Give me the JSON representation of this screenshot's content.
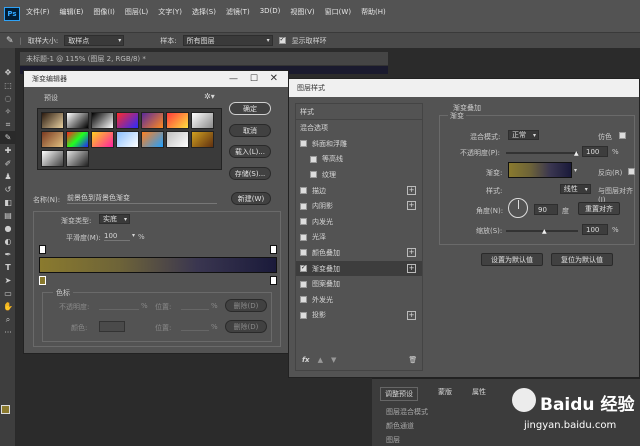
{
  "menubar": {
    "items": [
      "文件(F)",
      "编辑(E)",
      "图像(I)",
      "图层(L)",
      "文字(Y)",
      "选择(S)",
      "滤镜(T)",
      "3D(D)",
      "视图(V)",
      "窗口(W)",
      "帮助(H)"
    ],
    "app_badge": "Ps"
  },
  "optionsbar": {
    "sample_size_label": "取样大小:",
    "sample_size_value": "取样点",
    "sample_label": "样本:",
    "sample_value": "所有图层",
    "show_ring_label": "显示取样环"
  },
  "document": {
    "title": "未标题-1 @ 115% (图层 2, RGB/8) *"
  },
  "gradient_editor": {
    "title": "渐变编辑器",
    "presets_label": "预设",
    "btn_ok": "确定",
    "btn_cancel": "取消",
    "btn_load": "载入(L)...",
    "btn_save": "存储(S)...",
    "btn_new": "新建(W)",
    "name_label": "名称(N):",
    "name_value": "前景色到背景色渐变",
    "type_label": "渐变类型:",
    "type_value": "实底",
    "smooth_label": "平滑度(M):",
    "smooth_value": "100",
    "percent": "%",
    "stops_label": "色标",
    "opacity_label": "不透明度:",
    "color_label": "颜色:",
    "location_label": "位置:",
    "delete_label": "删除(D)",
    "gradient_colors": [
      "#8a7a2e",
      "#6e6438",
      "#3a3650",
      "#1a1a3a"
    ],
    "preset_colors": [
      [
        "#2b1a0f",
        "#e8d0a0"
      ],
      [
        "#ffffff",
        "#000000"
      ],
      [
        "#000000",
        "#ffffff"
      ],
      [
        "#ff2a2a",
        "#2a2aff"
      ],
      [
        "#5a2a9a",
        "#ff8a20"
      ],
      [
        "#ff3a3a",
        "#ffe040"
      ],
      [
        "#ffffff",
        "#8a8a8a"
      ],
      [
        "#7a3a20",
        "#e0c080"
      ],
      [
        "#ff2020",
        "#20ff20",
        "#2020ff"
      ],
      [
        "#ffd020",
        "#ff20a0"
      ],
      [
        "#8ac0ff",
        "#ffffff"
      ],
      [
        "#ff8020",
        "#20a0ff"
      ],
      [
        "#c0c0c0",
        "#ffffff"
      ],
      [
        "#d0a020",
        "#603010"
      ],
      [
        "#ffffff",
        "#404040"
      ],
      [
        "#e0e0e0",
        "#202020"
      ]
    ]
  },
  "layer_style": {
    "title": "图层样式",
    "styles_header": "样式",
    "blend_options": "混合选项",
    "items": [
      {
        "label": "斜面和浮雕",
        "checked": false,
        "plus": false
      },
      {
        "label": "等高线",
        "checked": false,
        "plus": false
      },
      {
        "label": "纹理",
        "checked": false,
        "plus": false
      },
      {
        "label": "描边",
        "checked": false,
        "plus": true
      },
      {
        "label": "内阴影",
        "checked": false,
        "plus": true
      },
      {
        "label": "内发光",
        "checked": false,
        "plus": false
      },
      {
        "label": "光泽",
        "checked": false,
        "plus": false
      },
      {
        "label": "颜色叠加",
        "checked": false,
        "plus": true
      },
      {
        "label": "渐变叠加",
        "checked": true,
        "plus": true
      },
      {
        "label": "图案叠加",
        "checked": false,
        "plus": false
      },
      {
        "label": "外发光",
        "checked": false,
        "plus": false
      },
      {
        "label": "投影",
        "checked": false,
        "plus": true
      }
    ],
    "footer_fx": "fx",
    "section_title": "渐变叠加",
    "sub_title": "渐变",
    "blend_mode_label": "混合模式:",
    "blend_mode_value": "正常",
    "dither_label": "仿色",
    "opacity_label": "不透明度(P):",
    "opacity_value": "100",
    "gradient_label": "渐变:",
    "reverse_label": "反向(R)",
    "style_label": "样式:",
    "style_value": "线性",
    "align_label": "与图层对齐(I)",
    "angle_label": "角度(N):",
    "angle_value": "90",
    "degree": "度",
    "reset_align": "重置对齐",
    "scale_label": "缩放(S):",
    "scale_value": "100",
    "percent": "%",
    "btn_default": "设置为默认值",
    "btn_reset": "复位为默认值"
  },
  "background_panel": {
    "tab1": "调整预设",
    "tab2": "蒙版",
    "tab3": "属性",
    "item1": "图层混合模式",
    "item2": "颜色通道",
    "item3": "图层"
  },
  "watermark": {
    "brand": "Baidu 经验",
    "url": "jingyan.baidu.com"
  }
}
